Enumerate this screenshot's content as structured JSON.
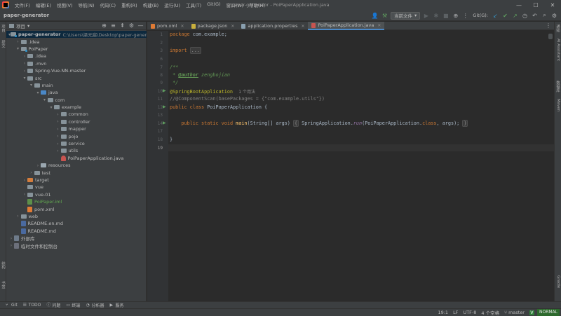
{
  "window": {
    "title": "paper-generator - PoiPaperApplication.java",
    "menu": [
      "文件(F)",
      "编辑(E)",
      "视图(V)",
      "导航(N)",
      "代码(C)",
      "重构(R)",
      "构建(B)",
      "运行(U)",
      "工具(T)",
      "Git(G)",
      "窗口(W)",
      "帮助(H)"
    ],
    "controls": {
      "minimize": "—",
      "maximize": "☐",
      "close": "✕"
    }
  },
  "toolbar": {
    "project_name": "paper-generator",
    "run_config": "当前文件",
    "git_label": "Git(G):"
  },
  "left_strip": {
    "top_tabs": [
      "项目",
      "提交"
    ],
    "bottom_tabs": [
      "结构",
      "书签"
    ]
  },
  "right_strip": {
    "tabs": [
      "通知",
      "AI Assistant",
      "数据库",
      "Maven",
      "Gradle"
    ]
  },
  "project_panel": {
    "title": "项目",
    "tree": [
      {
        "label": "paper-generator",
        "path": "C:\\Users\\梁元宸\\Desktop\\paper-generator",
        "indent": 0,
        "arrow": "▾",
        "icon": "module",
        "selected": true,
        "bold": true
      },
      {
        "label": ".idea",
        "indent": 1,
        "arrow": "›",
        "icon": "pkg"
      },
      {
        "label": "PoiPaper",
        "indent": 1,
        "arrow": "▾",
        "icon": "module"
      },
      {
        "label": ".idea",
        "indent": 2,
        "arrow": "›",
        "icon": "pkg"
      },
      {
        "label": ".mvn",
        "indent": 2,
        "arrow": "›",
        "icon": "pkg"
      },
      {
        "label": "Spring-Vue-NN-master",
        "indent": 2,
        "arrow": "›",
        "icon": "pkg"
      },
      {
        "label": "src",
        "indent": 2,
        "arrow": "▾",
        "icon": "pkg"
      },
      {
        "label": "main",
        "indent": 3,
        "arrow": "▾",
        "icon": "pkg"
      },
      {
        "label": "java",
        "indent": 4,
        "arrow": "▾",
        "icon": "src"
      },
      {
        "label": "com",
        "indent": 5,
        "arrow": "▾",
        "icon": "pkg"
      },
      {
        "label": "example",
        "indent": 6,
        "arrow": "▾",
        "icon": "pkg"
      },
      {
        "label": "common",
        "indent": 7,
        "arrow": "›",
        "icon": "pkg"
      },
      {
        "label": "controller",
        "indent": 7,
        "arrow": "›",
        "icon": "pkg"
      },
      {
        "label": "mapper",
        "indent": 7,
        "arrow": "›",
        "icon": "pkg"
      },
      {
        "label": "pojo",
        "indent": 7,
        "arrow": "›",
        "icon": "pkg"
      },
      {
        "label": "service",
        "indent": 7,
        "arrow": "›",
        "icon": "pkg"
      },
      {
        "label": "utils",
        "indent": 7,
        "arrow": "›",
        "icon": "pkg"
      },
      {
        "label": "PoiPaperApplication.java",
        "indent": 7,
        "arrow": "",
        "icon": "java"
      },
      {
        "label": "resources",
        "indent": 4,
        "arrow": "›",
        "icon": "res"
      },
      {
        "label": "test",
        "indent": 3,
        "arrow": "›",
        "icon": "pkg"
      },
      {
        "label": "target",
        "indent": 2,
        "arrow": "›",
        "icon": "excluded"
      },
      {
        "label": "vue",
        "indent": 2,
        "arrow": "",
        "icon": "pkg"
      },
      {
        "label": "vue-01",
        "indent": 2,
        "arrow": "›",
        "icon": "pkg"
      },
      {
        "label": "PoiPaper.iml",
        "indent": 2,
        "arrow": "",
        "icon": "iml",
        "green": true
      },
      {
        "label": "pom.xml",
        "indent": 2,
        "arrow": "",
        "icon": "xml"
      },
      {
        "label": "web",
        "indent": 1,
        "arrow": "›",
        "icon": "pkg"
      },
      {
        "label": "README.en.md",
        "indent": 1,
        "arrow": "",
        "icon": "md"
      },
      {
        "label": "README.md",
        "indent": 1,
        "arrow": "",
        "icon": "md"
      },
      {
        "label": "外部库",
        "indent": 0,
        "arrow": "›",
        "icon": "lib"
      },
      {
        "label": "临时文件和控制台",
        "indent": 0,
        "arrow": "›",
        "icon": "scratch"
      }
    ]
  },
  "editor_tabs": [
    {
      "label": "pom.xml",
      "icon": "xml",
      "active": false
    },
    {
      "label": "package.json",
      "icon": "json",
      "active": false
    },
    {
      "label": "application.properties",
      "icon": "props",
      "active": false
    },
    {
      "label": "PoiPaperApplication.java",
      "icon": "java",
      "active": true
    }
  ],
  "editor": {
    "line_numbers": [
      "1",
      "2",
      "3",
      "6",
      "7",
      "8",
      "9",
      "10",
      "11",
      "12",
      "13",
      "14",
      "17",
      "18",
      "19"
    ],
    "code": {
      "l1_kw": "package",
      "l1_rest": " com.example;",
      "l3_kw": "import",
      "l3_fold": "...",
      "l7": "/**",
      "l8_star": " * ",
      "l8_tag": "@author",
      "l8_name": " zengbojian",
      "l9": " */",
      "l10_ann": "@SpringBootApplication",
      "l10_hint": "1 个用法",
      "l11": "//@ComponentScan(basePackages = {\"com.example.utils\"})",
      "l12_kw": "public class",
      "l12_name": " PoiPaperApplication {",
      "l14_kw": "public static void",
      "l14_name": "main",
      "l14_args": "(String[] args) ",
      "l14_fold_open": "{",
      "l14_body": " SpringApplication.",
      "l14_run": "run",
      "l14_body2": "(PoiPaperApplication.",
      "l14_class": "class",
      "l14_body3": ", args); ",
      "l14_fold_close": "}",
      "l17": "}"
    }
  },
  "bottom_tools": [
    {
      "label": "Git",
      "icon": "⑂"
    },
    {
      "label": "TODO",
      "icon": "☰"
    },
    {
      "label": "问题",
      "icon": "ⓘ"
    },
    {
      "label": "终端",
      "icon": "▭"
    },
    {
      "label": "分析器",
      "icon": "◔"
    },
    {
      "label": "服务",
      "icon": "▶"
    }
  ],
  "status": {
    "position": "19:1",
    "line_sep": "LF",
    "encoding": "UTF-8",
    "indent": "4 个空格",
    "branch": "master",
    "vim_mode": "NORMAL",
    "plugin": "V"
  }
}
